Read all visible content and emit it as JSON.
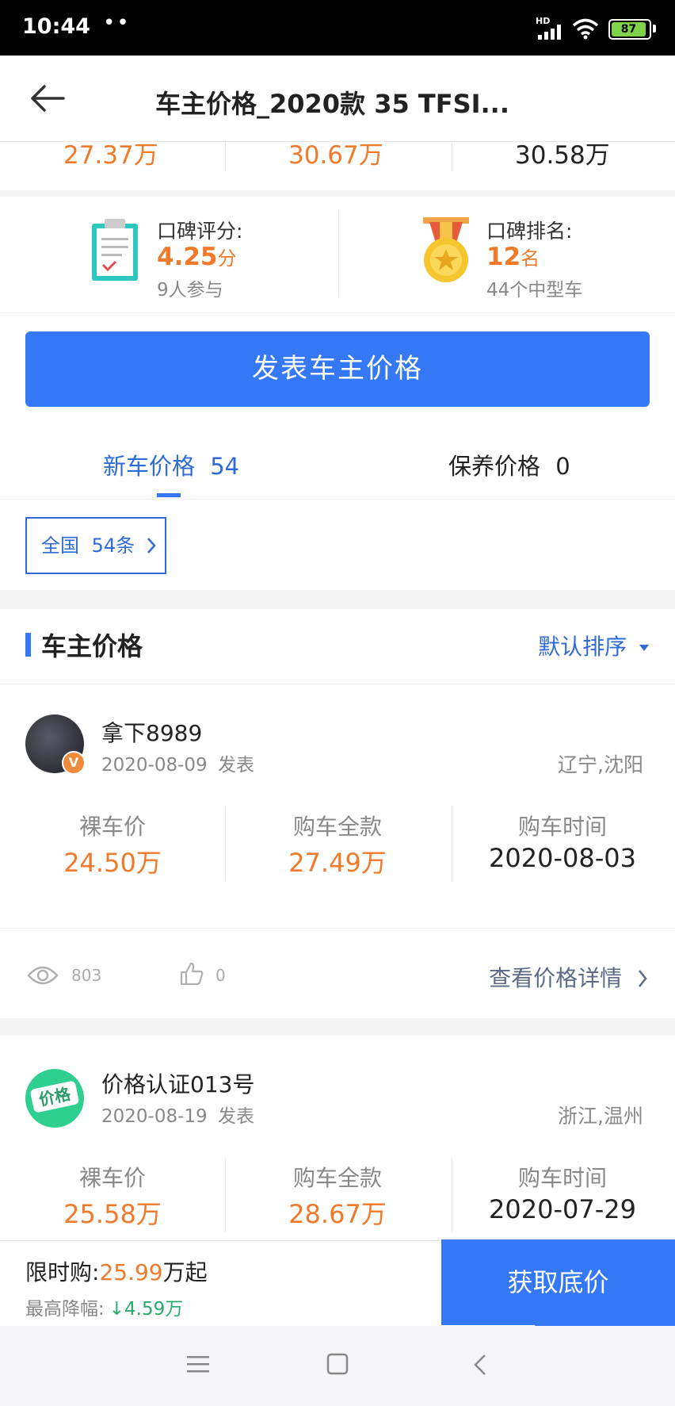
{
  "status_bar": {
    "time": "10:44",
    "dots": "••",
    "battery": "87",
    "network": "HD"
  },
  "header": {
    "title": "车主价格_2020款 35 TFSI..."
  },
  "top_prices": [
    "27.37万",
    "30.67万",
    "30.58万"
  ],
  "rating": {
    "score_label": "口碑评分:",
    "score_value": "4.25",
    "score_unit": "分",
    "score_participants": "9人参与",
    "rank_label": "口碑排名:",
    "rank_value": "12",
    "rank_unit": "名",
    "rank_scope": "44个中型车"
  },
  "publish_button": "发表车主价格",
  "tabs": [
    {
      "label": "新车价格",
      "count": "54",
      "active": true
    },
    {
      "label": "保养价格",
      "count": "0",
      "active": false
    }
  ],
  "region_filter": {
    "label": "全国",
    "count": "54条"
  },
  "section": {
    "title": "车主价格",
    "sort": "默认排序"
  },
  "col_labels": {
    "bare": "裸车价",
    "full": "购车全款",
    "time": "购车时间"
  },
  "posts": [
    {
      "user": "拿下8989",
      "date": "2020-08-09",
      "date_suffix": "发表",
      "location": "辽宁,沈阳",
      "bare_price": "24.50万",
      "full_price": "27.49万",
      "purchase_date": "2020-08-03",
      "views": "803",
      "likes": "0",
      "details_link": "查看价格详情"
    },
    {
      "user": "价格认证013号",
      "date": "2020-08-19",
      "date_suffix": "发表",
      "location": "浙江,温州",
      "bare_price": "25.58万",
      "full_price": "28.67万",
      "purchase_date": "2020-07-29",
      "avatar_text": "价格"
    }
  ],
  "promo": {
    "label": "限时购:",
    "price": "25.99",
    "price_suffix": "万起",
    "drop_label": "最高降幅:",
    "drop_arrow": "↓",
    "drop_value": "4.59万",
    "button": "获取底价"
  },
  "colors": {
    "accent": "#3478f6",
    "price": "#ef7a2a",
    "drop": "#2aa96b"
  }
}
